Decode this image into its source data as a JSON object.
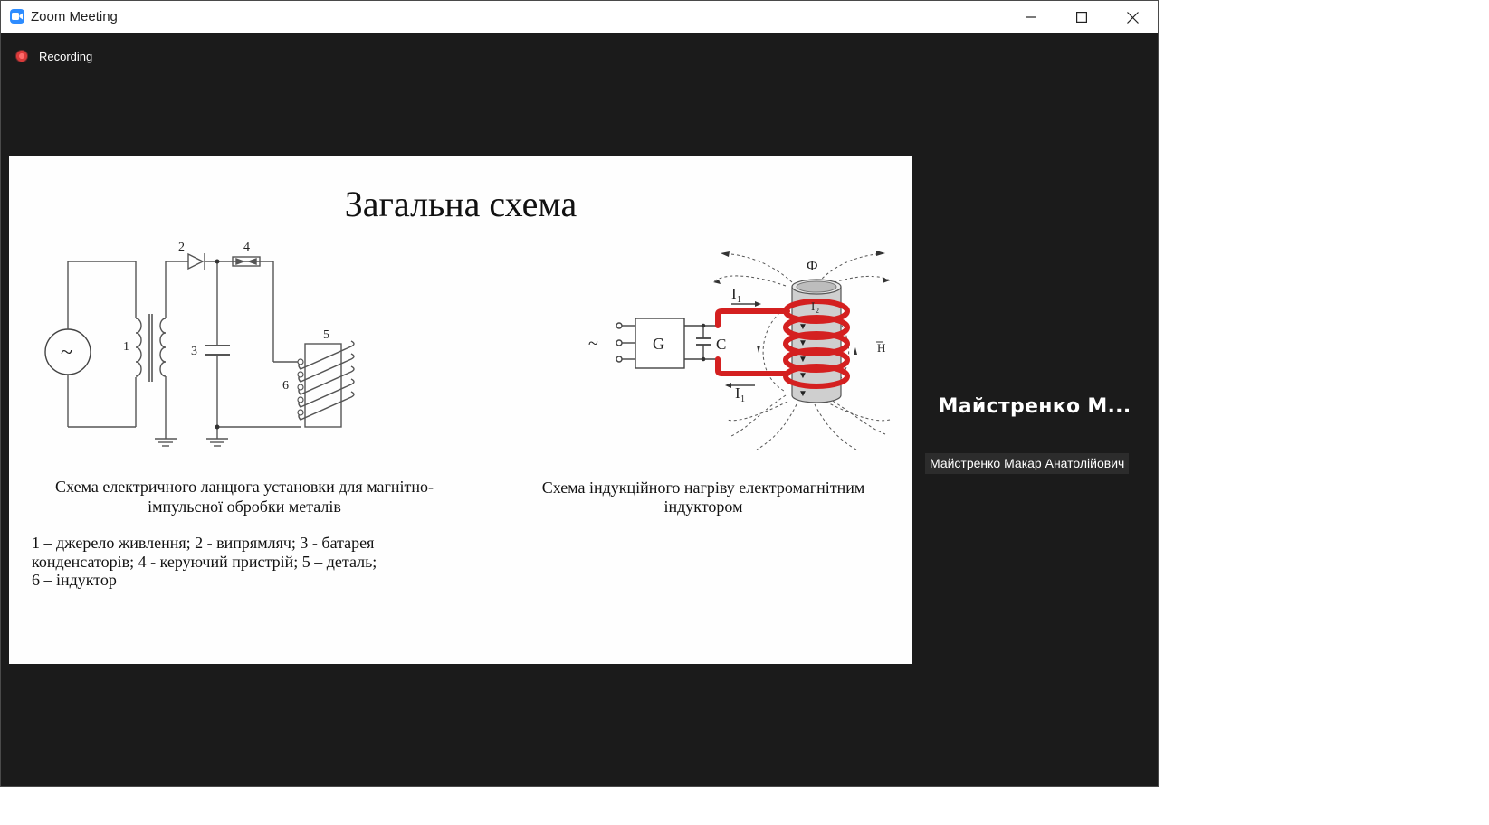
{
  "window": {
    "title": "Zoom Meeting",
    "icon": "zoom-camera-icon",
    "controls": [
      "minimize-icon",
      "maximize-icon",
      "close-icon"
    ]
  },
  "recording": {
    "label": "Recording",
    "color": "#d93a3a"
  },
  "slide": {
    "title": "Загальна схема",
    "left_diagram": {
      "labels": [
        "1",
        "2",
        "3",
        "4",
        "5",
        "6"
      ],
      "source_symbol": "~"
    },
    "left_caption": "Схема електричного ланцюга установки для магнітно-імпульсної обробки металів",
    "legend_lines": [
      "1 – джерело живлення; 2 - випрямляч; 3 - батарея",
      "конденсаторів; 4 - керуючий пристрій; 5 – деталь;",
      "6 – індуктор"
    ],
    "right_diagram": {
      "source_symbol": "~",
      "generator": "G",
      "capacitor": "C",
      "current_top": "I",
      "current_top_sub": "1",
      "current_bottom": "I",
      "current_bottom_sub": "1",
      "inner_current": "I",
      "inner_current_sub": "2",
      "flux": "Φ",
      "field": "H",
      "coil_color": "#d42020"
    },
    "right_caption": "Схема індукційного нагріву електромагнітним індуктором"
  },
  "participant": {
    "display_name": "Майстренко  М...",
    "full_name": "Майстренко Макар Анатолійович"
  },
  "colors": {
    "meeting_bg": "#1b1b1b",
    "slide_bg": "#fefefe",
    "accent": "#2d8cff"
  }
}
